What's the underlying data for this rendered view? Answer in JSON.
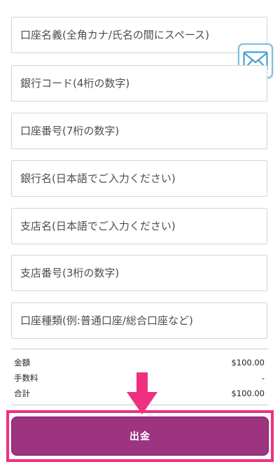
{
  "form": {
    "fields": [
      {
        "placeholder": "口座名義(全角カナ/氏名の間にスペース)"
      },
      {
        "placeholder": "銀行コード(4桁の数字)"
      },
      {
        "placeholder": "口座番号(7桁の数字)"
      },
      {
        "placeholder": "銀行名(日本語でご入力ください)"
      },
      {
        "placeholder": "支店名(日本語でご入力ください)"
      },
      {
        "placeholder": "支店番号(3桁の数字)"
      },
      {
        "placeholder": "口座種類(例:普通口座/総合口座など)"
      }
    ]
  },
  "summary": {
    "amount_label": "金額",
    "amount_value": "$100.00",
    "fee_label": "手数料",
    "fee_value": "-",
    "total_label": "合計",
    "total_value": "$100.00"
  },
  "actions": {
    "withdraw_label": "出金"
  },
  "icons": {
    "mail": "envelope-icon",
    "arrow": "arrow-down-icon"
  },
  "colors": {
    "button_bg": "#9c3480",
    "highlight": "#ef2f80",
    "mail_accent": "#7bbde3"
  }
}
